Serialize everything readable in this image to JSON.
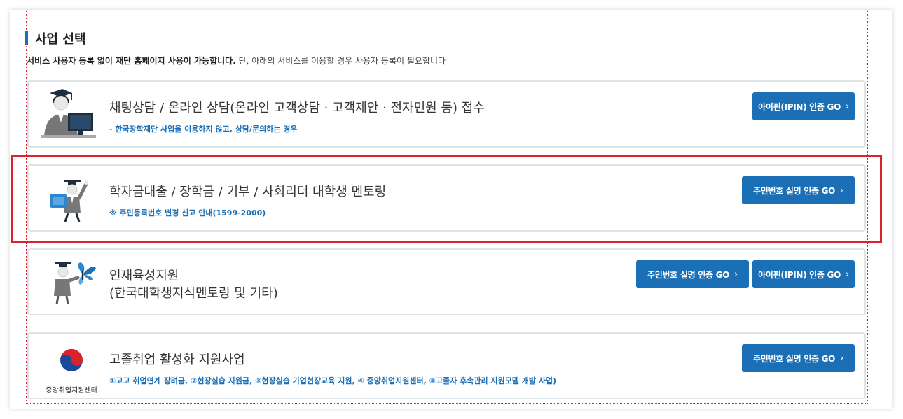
{
  "section": {
    "title": "사업 선택",
    "desc_bold": "서비스 사용자 등록 없이 재단 홈페이지 사용이 가능합니다.",
    "desc_normal": " 단, 아래의 서비스를 이용할 경우 사용자 등록이 필요합니다"
  },
  "cards": [
    {
      "title": "채팅상담 / 온라인 상담(온라인 고객상담 · 고객제안 · 전자민원 등) 접수",
      "subtitle": "- 한국장학재단 사업을 이용하지 않고, 상담/문의하는 경우",
      "icon": "counselor-icon",
      "buttons": [
        "아이핀(IPIN) 인증 GO"
      ]
    },
    {
      "title": "학자금대출 / 장학금 / 기부 / 사회리더 대학생 멘토링",
      "subtitle": "※ 주민등록번호 변경 신고 안내(1599-2000)",
      "icon": "graduate-icon",
      "buttons": [
        "주민번호 실명 인증 GO"
      ]
    },
    {
      "title_line1": "인재육성지원",
      "title_line2": "(한국대학생지식멘토링 및 기타)",
      "icon": "mentor-butterfly-icon",
      "buttons": [
        "주민번호 실명 인증 GO",
        "아이핀(IPIN) 인증 GO"
      ]
    },
    {
      "title": "고졸취업 활성화 지원사업",
      "subtitle": "①고교 취업연계 장려금, ②현장실습 지원금, ③현장실습 기업현장교육 지원, ④ 중앙취업지원센터, ⑤고졸자 후속관리 지원모델 개발 사업)",
      "icon": "taegeuk-logo-icon",
      "logo_text": "중앙취업지원센터",
      "buttons": [
        "주민번호 실명 인증 GO"
      ]
    }
  ],
  "chevron": "›",
  "colors": {
    "accent": "#1a6fb6",
    "highlight": "#d9232d",
    "card_border": "#dde4e8"
  }
}
